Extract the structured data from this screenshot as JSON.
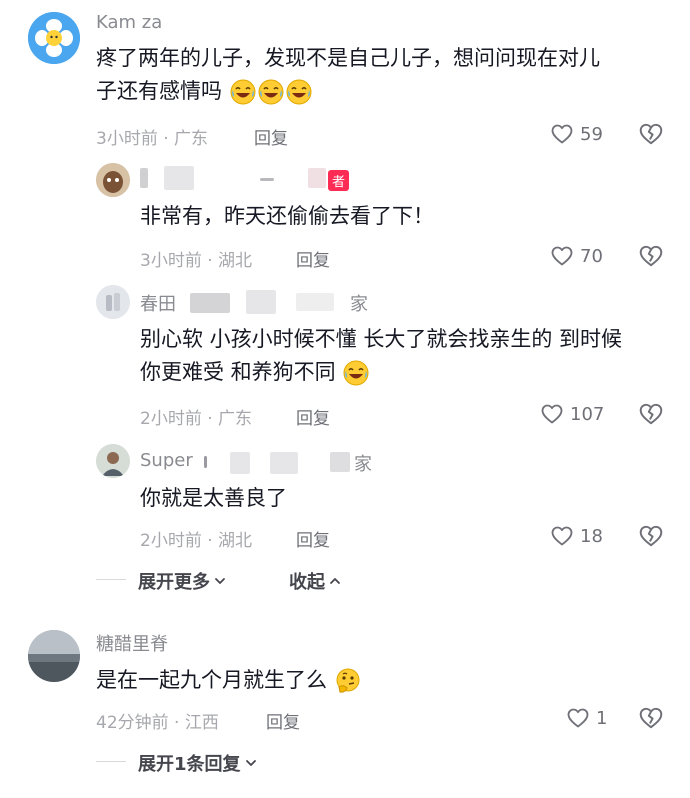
{
  "comments": [
    {
      "username": "Kam za",
      "text_line1": "疼了两年的儿子，发现不是自己儿子，想问问现在对儿",
      "text_line2": "子还有感情吗",
      "meta": "3小时前 · 广东",
      "reply_label": "回复",
      "likes": "59",
      "emoji": "laughing-crying"
    },
    {
      "username": "",
      "author_tag": "者",
      "text_line1": "非常有，昨天还偷偷去看了下！",
      "meta": "3小时前 · 湖北",
      "reply_label": "回复",
      "likes": "70"
    },
    {
      "username": "春田",
      "username_suffix": "家",
      "text_line1": "别心软 小孩小时候不懂 长大了就会找亲生的 到时候",
      "text_line2": "你更难受 和养狗不同",
      "meta": "2小时前 · 广东",
      "reply_label": "回复",
      "likes": "107"
    },
    {
      "username": "Super",
      "username_suffix": "家",
      "text_line1": "你就是太善良了",
      "meta": "2小时前 · 湖北",
      "reply_label": "回复",
      "likes": "18"
    },
    {
      "username": "糖醋里脊",
      "text_line1": "是在一起九个月就生了么",
      "meta": "42分钟前 · 江西",
      "reply_label": "回复",
      "likes": "1"
    }
  ],
  "thread_controls": {
    "expand_more": "展开更多",
    "collapse": "收起",
    "expand_one_reply": "展开1条回复"
  }
}
